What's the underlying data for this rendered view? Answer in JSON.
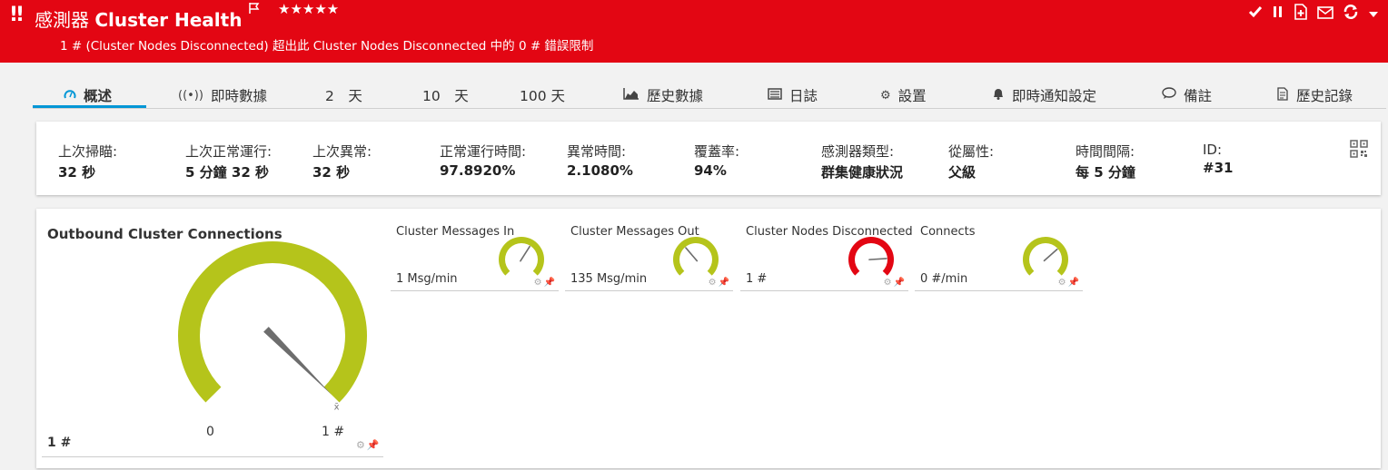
{
  "header": {
    "excl": "!!",
    "title_prefix": "感測器",
    "title_name": "Cluster Health",
    "flag_icon": "flag-icon",
    "stars": "★★★★★",
    "message": "1 # (Cluster Nodes Disconnected) 超出此 Cluster Nodes Disconnected 中的 0 # 錯誤限制",
    "bg_color": "#e30613",
    "actions": [
      "check-icon",
      "pause-icon",
      "add-icon",
      "mail-icon",
      "refresh-icon",
      "dropdown-icon"
    ]
  },
  "tabs": [
    {
      "label": "概述",
      "icon": "gauge-icon",
      "active": true
    },
    {
      "label": "即時數據",
      "icon": "live-icon"
    },
    {
      "label": "2　天"
    },
    {
      "label": "10　天"
    },
    {
      "label": "100 天"
    },
    {
      "label": "歷史數據",
      "icon": "area-chart-icon"
    },
    {
      "label": "日誌",
      "icon": "log-icon"
    },
    {
      "label": "設置",
      "icon": "gear-icon"
    },
    {
      "label": "即時通知設定",
      "icon": "bell-icon"
    },
    {
      "label": "備註",
      "icon": "comment-icon"
    },
    {
      "label": "歷史記錄",
      "icon": "history-icon"
    }
  ],
  "info": [
    {
      "label": "上次掃瞄:",
      "value": "32 秒"
    },
    {
      "label": "上次正常運行:",
      "value": "5 分鐘 32 秒"
    },
    {
      "label": "上次異常:",
      "value": "32 秒"
    },
    {
      "label": "正常運行時間:",
      "value": "97.8920%"
    },
    {
      "label": "異常時間:",
      "value": "2.1080%"
    },
    {
      "label": "覆蓋率:",
      "value": "94%"
    },
    {
      "label": "感測器類型:",
      "value": "群集健康狀況"
    },
    {
      "label": "從屬性:",
      "value": "父級"
    },
    {
      "label": "時間間隔:",
      "value": "每 5 分鐘"
    },
    {
      "label": "ID:",
      "value": "#31"
    }
  ],
  "big_gauge": {
    "title": "Outbound Cluster Connections",
    "value": "1 #",
    "min": "0",
    "max": "1 #",
    "fraction": 1.0,
    "color": "#b5c41b",
    "marker": "x̄"
  },
  "small_gauges": [
    {
      "title": "Cluster Messages In",
      "value": "1 Msg/min",
      "color": "#b5c41b",
      "fraction": 0.62
    },
    {
      "title": "Cluster Messages Out",
      "value": "135 Msg/min",
      "color": "#b5c41b",
      "fraction": 0.35
    },
    {
      "title": "Cluster Nodes Disconnected",
      "value": "1 #",
      "color": "#e30613",
      "fraction": 0.82
    },
    {
      "title": "Connects",
      "value": "0 #/min",
      "color": "#b5c41b",
      "fraction": 0.68
    }
  ]
}
